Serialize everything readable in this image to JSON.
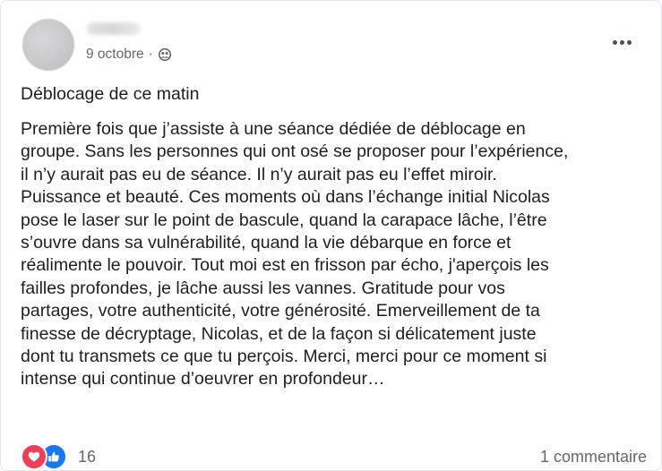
{
  "post": {
    "date": "9 octobre",
    "separator": "·",
    "audience_icon": "friends-icon",
    "more_icon": "more-options-icon",
    "title": "Déblocage de ce matin",
    "body_lines": [
      "Première fois que j’assiste à une séance dédiée de déblocage en",
      "groupe. Sans les personnes qui ont osé se proposer pour l’expérience,",
      "il n’y aurait pas eu de séance. Il n’y aurait pas eu l’effet miroir.",
      "Puissance et beauté. Ces moments où dans l’échange initial Nicolas",
      "pose le laser sur le point de bascule, quand la carapace lâche, l’être",
      "s’ouvre dans sa vulnérabilité, quand la vie débarque en force et",
      "réalimente le pouvoir. Tout moi est en frisson par écho, j'aperçois les",
      "failles profondes, je lâche aussi les vannes. Gratitude pour vos",
      "partages, votre authenticité, votre générosité. Emerveillement de ta",
      "finesse de décryptage, Nicolas, et de la façon si délicatement juste",
      "dont tu transmets ce que tu perçois. Merci, merci pour ce moment si",
      "intense qui continue d’oeuvrer en profondeur…"
    ]
  },
  "footer": {
    "reaction_icons": [
      "love-reaction-icon",
      "like-reaction-icon"
    ],
    "reaction_count": "16",
    "comments_label": "1 commentaire"
  },
  "colors": {
    "text": "#1c1e21",
    "secondary": "#65676b",
    "love": "#f33e58",
    "like": "#1877f2"
  }
}
